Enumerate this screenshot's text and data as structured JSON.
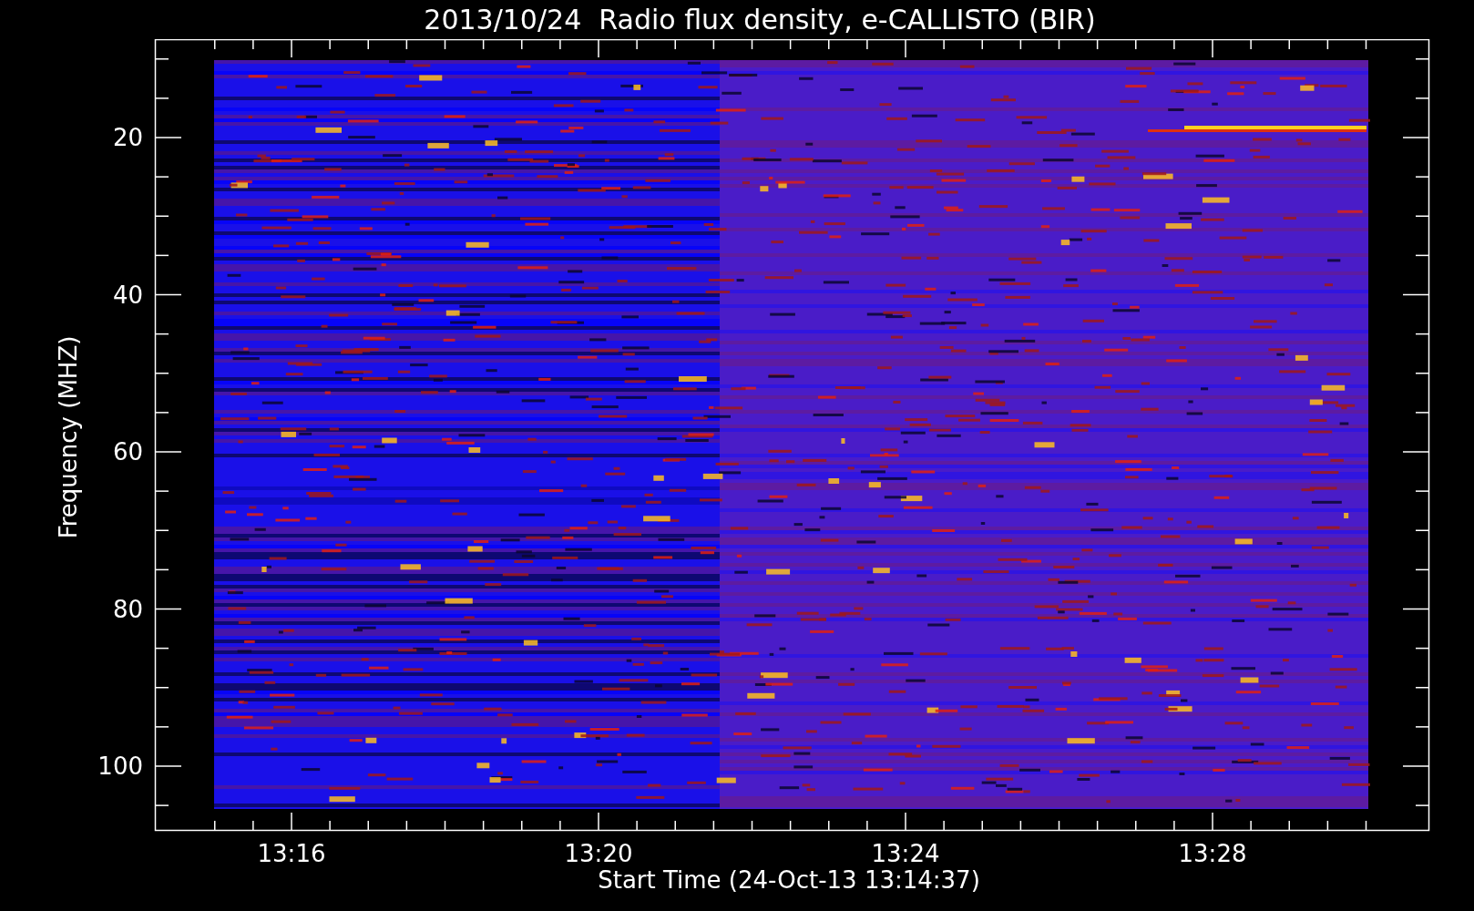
{
  "plot": {
    "title": "2013/10/24  Radio flux density, e-CALLISTO (BIR)",
    "ylabel": "Frequency (MHZ)",
    "xlabel": "Start Time (24-Oct-13 13:14:37)",
    "yticks": [
      "20",
      "40",
      "60",
      "80",
      "100"
    ],
    "xticks": [
      "13:16",
      "13:20",
      "13:24",
      "13:28"
    ]
  }
}
